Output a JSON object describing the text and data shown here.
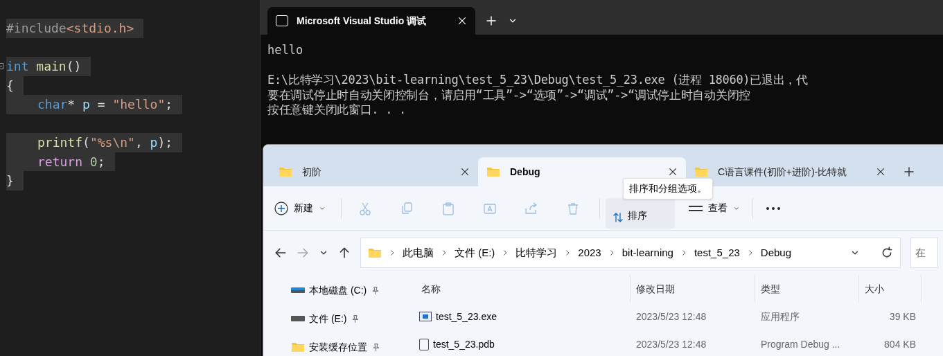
{
  "editor": {
    "lines": [
      {
        "kind": "code",
        "tokens": [
          {
            "text": "#include",
            "kind": "preproc"
          },
          {
            "text": "<stdio.h>",
            "kind": "string"
          }
        ]
      },
      {
        "kind": "blank"
      },
      {
        "kind": "code",
        "tokens": [
          {
            "text": "int ",
            "kind": "keyword"
          },
          {
            "text": "main",
            "kind": "func"
          },
          {
            "text": "()",
            "kind": "plain"
          }
        ],
        "children": [
          {
            "kind": "code",
            "tokens": [
              {
                "text": "{",
                "kind": "plain"
              }
            ]
          },
          {
            "kind": "block",
            "children": [
              {
                "kind": "code",
                "tokens": [
                  {
                    "text": "char",
                    "kind": "keyword"
                  },
                  {
                    "text": "* ",
                    "kind": "plain"
                  },
                  {
                    "text": "p",
                    "kind": "var"
                  },
                  {
                    "text": " = ",
                    "kind": "plain"
                  },
                  {
                    "text": "\"hello\"",
                    "kind": "string"
                  },
                  {
                    "text": ";",
                    "kind": "plain"
                  }
                ]
              },
              {
                "kind": "blank"
              },
              {
                "kind": "code",
                "tokens": [
                  {
                    "text": "printf",
                    "kind": "func"
                  },
                  {
                    "text": "(",
                    "kind": "plain"
                  },
                  {
                    "text": "\"%s\\n\"",
                    "kind": "string"
                  },
                  {
                    "text": ", ",
                    "kind": "plain"
                  },
                  {
                    "text": "p",
                    "kind": "var"
                  },
                  {
                    "text": ");",
                    "kind": "plain"
                  }
                ]
              },
              {
                "kind": "code",
                "tokens": [
                  {
                    "text": "return ",
                    "kind": "control"
                  },
                  {
                    "text": "0",
                    "kind": "number"
                  },
                  {
                    "text": ";",
                    "kind": "plain"
                  }
                ]
              }
            ]
          },
          {
            "kind": "code",
            "tokens": [
              {
                "text": "}",
                "kind": "plain"
              }
            ]
          }
        ]
      }
    ]
  },
  "console": {
    "tab_title": "Microsoft Visual Studio 调试",
    "output": "hello",
    "messages": [
      "E:\\比特学习\\2023\\bit-learning\\test_5_23\\Debug\\test_5_23.exe (进程 18060)已退出，代",
      "要在调试停止时自动关闭控制台，请启用“工具”->“选项”->“调试”->“调试停止时自动关闭控",
      "按任意键关闭此窗口. . ."
    ]
  },
  "explorer": {
    "tabs": [
      {
        "label": "初阶",
        "selected": false
      },
      {
        "label": "Debug",
        "selected": true
      },
      {
        "label": "C语言课件(初阶+进阶)-比特就",
        "selected": false
      }
    ],
    "toolbar": {
      "new_label": "新建",
      "tools": [
        {
          "kind": "cut",
          "disabled": true
        },
        {
          "kind": "copy",
          "disabled": true
        },
        {
          "kind": "paste",
          "disabled": true
        },
        {
          "kind": "rename",
          "disabled": true
        },
        {
          "kind": "share",
          "disabled": true
        },
        {
          "kind": "delete",
          "disabled": true
        }
      ],
      "sort_label": "排序",
      "view_label": "查看"
    },
    "tooltip": "排序和分组选项。",
    "breadcrumb": [
      "此电脑",
      "文件 (E:)",
      "比特学习",
      "2023",
      "bit-learning",
      "test_5_23",
      "Debug"
    ],
    "search_placeholder": "在",
    "sidebar": [
      {
        "label": "本地磁盘 (C:)",
        "kind": "drive-c"
      },
      {
        "label": "文件 (E:)",
        "kind": "drive"
      },
      {
        "label": "安装缓存位置",
        "kind": "folder"
      }
    ],
    "columns": [
      "名称",
      "修改日期",
      "类型",
      "大小"
    ],
    "rows": [
      {
        "name": "test_5_23.exe",
        "kind": "exe",
        "date": "2023/5/23 12:48",
        "type": "应用程序",
        "size": "39 KB"
      },
      {
        "name": "test_5_23.pdb",
        "kind": "pdb",
        "date": "2023/5/23 12:48",
        "type": "Program Debug ...",
        "size": "804 KB"
      }
    ]
  }
}
